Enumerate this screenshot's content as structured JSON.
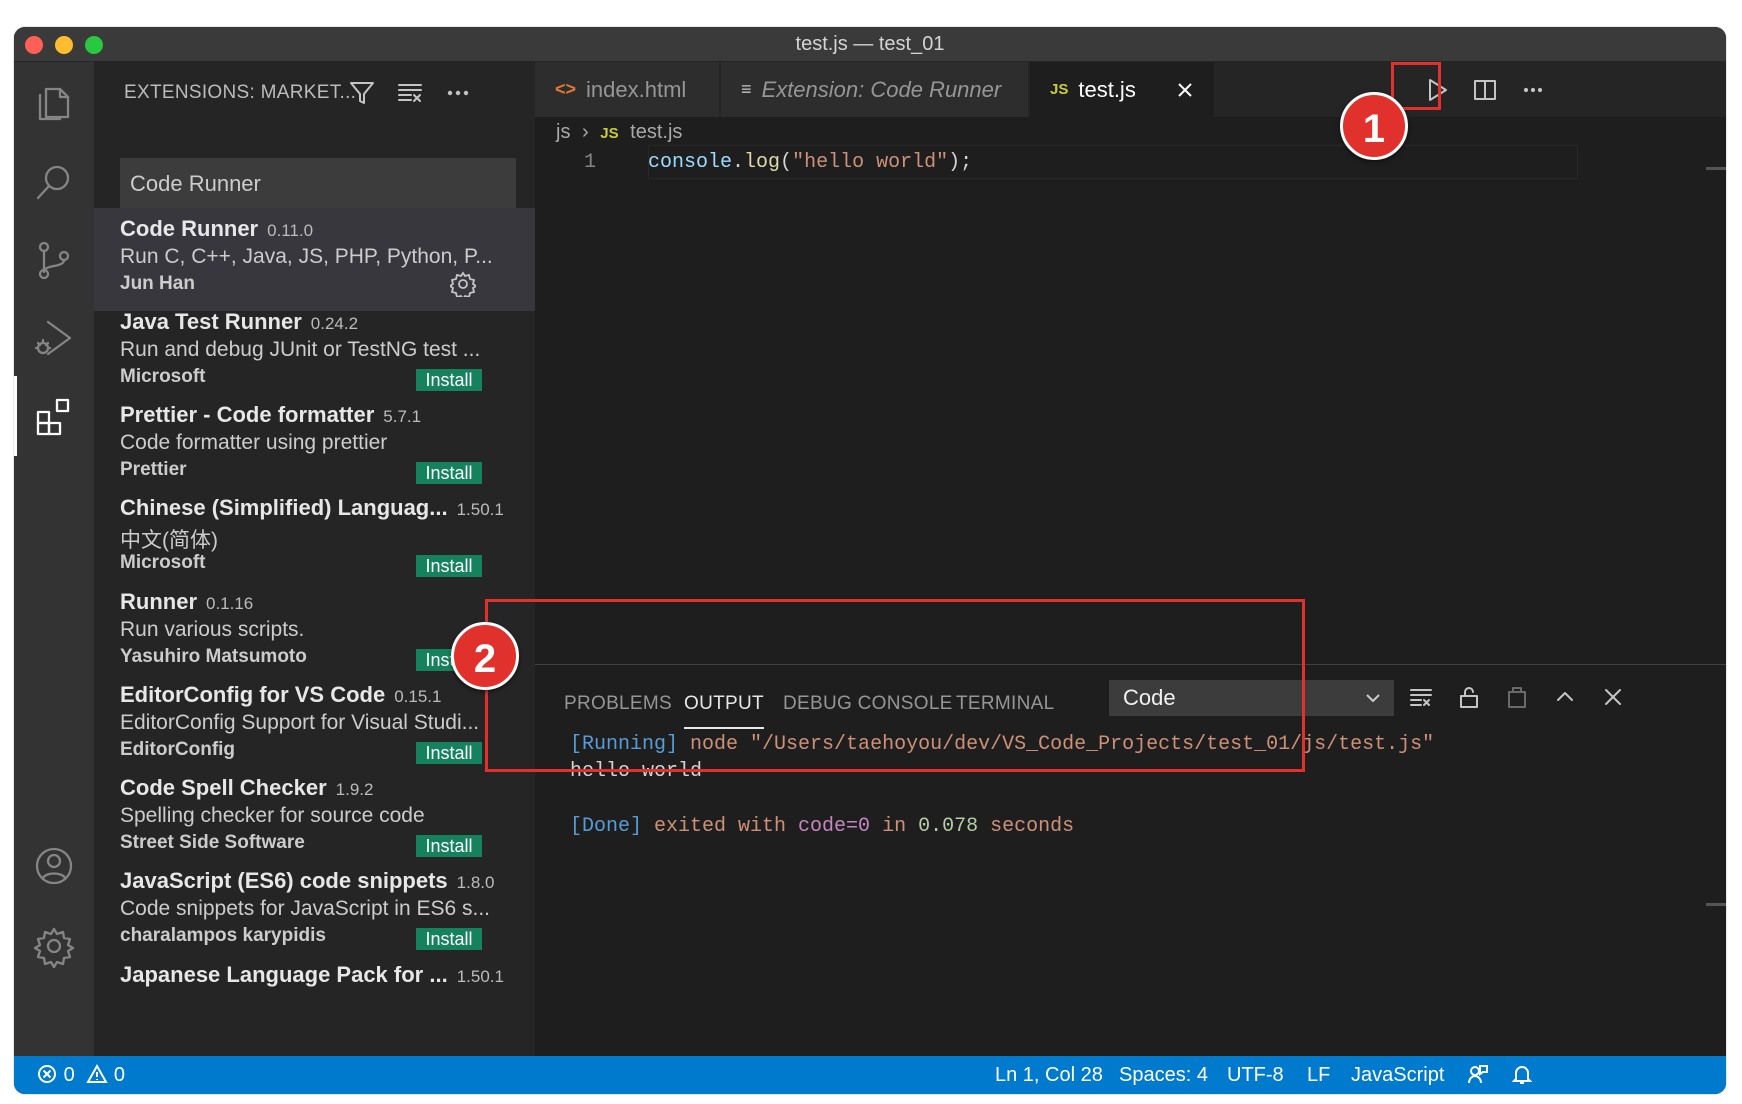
{
  "window": {
    "title": "test.js — test_01"
  },
  "colors": {
    "accent": "#007acc",
    "install": "#16825d",
    "annotation": "#e0312d",
    "close": "#ff5f57",
    "minimize": "#febc2e",
    "zoom": "#28c840"
  },
  "activity_bar": {
    "items": [
      "files-icon",
      "search-icon",
      "source-control-icon",
      "run-debug-icon",
      "extensions-icon",
      "account-icon",
      "gear-icon"
    ]
  },
  "sidebar": {
    "title": "EXTENSIONS: MARKET...",
    "search_value": "Code Runner",
    "extensions": [
      {
        "name": "Code Runner",
        "version": "0.11.0",
        "description": "Run C, C++, Java, JS, PHP, Python, P...",
        "publisher": "Jun Han",
        "action": ""
      },
      {
        "name": "Java Test Runner",
        "version": "0.24.2",
        "description": "Run and debug JUnit or TestNG test ...",
        "publisher": "Microsoft",
        "action": "Install"
      },
      {
        "name": "Prettier - Code formatter",
        "version": "5.7.1",
        "description": "Code formatter using prettier",
        "publisher": "Prettier",
        "action": "Install"
      },
      {
        "name": "Chinese (Simplified) Languag...",
        "version": "1.50.1",
        "description": "中文(简体)",
        "publisher": "Microsoft",
        "action": "Install"
      },
      {
        "name": "Runner",
        "version": "0.1.16",
        "description": "Run various scripts.",
        "publisher": "Yasuhiro Matsumoto",
        "action": "Install"
      },
      {
        "name": "EditorConfig for VS Code",
        "version": "0.15.1",
        "description": "EditorConfig Support for Visual Studi...",
        "publisher": "EditorConfig",
        "action": "Install"
      },
      {
        "name": "Code Spell Checker",
        "version": "1.9.2",
        "description": "Spelling checker for source code",
        "publisher": "Street Side Software",
        "action": "Install"
      },
      {
        "name": "JavaScript (ES6) code snippets",
        "version": "1.8.0",
        "description": "Code snippets for JavaScript in ES6 s...",
        "publisher": "charalampos karypidis",
        "action": "Install"
      },
      {
        "name": "Japanese Language Pack for ...",
        "version": "1.50.1",
        "description": "",
        "publisher": "",
        "action": ""
      }
    ]
  },
  "editor": {
    "tabs": [
      {
        "icon": "<>",
        "label": "index.html"
      },
      {
        "icon": "≡",
        "label": "Extension: Code Runner"
      },
      {
        "icon": "JS",
        "label": "test.js"
      }
    ],
    "breadcrumb": {
      "folder": "js",
      "file_icon": "JS",
      "file": "test.js"
    },
    "line_number": "1",
    "code": {
      "obj": "console",
      "dot": ".",
      "fn": "log",
      "open": "(",
      "str": "\"hello world\"",
      "close": ");"
    }
  },
  "panel": {
    "tabs": [
      "PROBLEMS",
      "OUTPUT",
      "DEBUG CONSOLE",
      "TERMINAL"
    ],
    "active_tab": "OUTPUT",
    "channel": "Code",
    "output": {
      "running_tag": "[Running]",
      "running_cmd": " node \"/Users/taehoyou/dev/VS_Code_Projects/test_01/js/test.js\"",
      "result": "hello world",
      "done_tag": "[Done]",
      "done_a": " exited with ",
      "done_code": "code=0",
      "done_b": " in ",
      "done_time": "0.078",
      "done_c": " seconds"
    }
  },
  "status_bar": {
    "errors": "0",
    "warnings": "0",
    "position": "Ln 1, Col 28",
    "spaces": "Spaces: 4",
    "encoding": "UTF-8",
    "eol": "LF",
    "language": "JavaScript"
  },
  "annotations": {
    "badge_1": "1",
    "badge_2": "2"
  }
}
